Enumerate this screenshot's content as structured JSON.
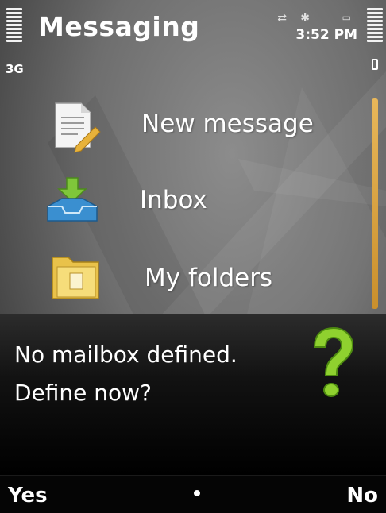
{
  "status_bar": {
    "app_title": "Messaging",
    "time": "3:52 PM",
    "network": "3G",
    "indicators": [
      "transfer-icon",
      "bluetooth-icon",
      "memory-card-icon"
    ]
  },
  "menu": {
    "items": [
      {
        "label": "New message",
        "icon": "new-message-icon"
      },
      {
        "label": "Inbox",
        "icon": "inbox-icon"
      },
      {
        "label": "My folders",
        "icon": "folder-icon"
      }
    ]
  },
  "dialog": {
    "line1": "No mailbox defined.",
    "line2": "Define now?",
    "icon": "question-icon"
  },
  "softkeys": {
    "left": "Yes",
    "right": "No"
  },
  "colors": {
    "accent": "#e8b75a",
    "dialog_bg": "#121212",
    "question_green": "#8fd12f"
  }
}
